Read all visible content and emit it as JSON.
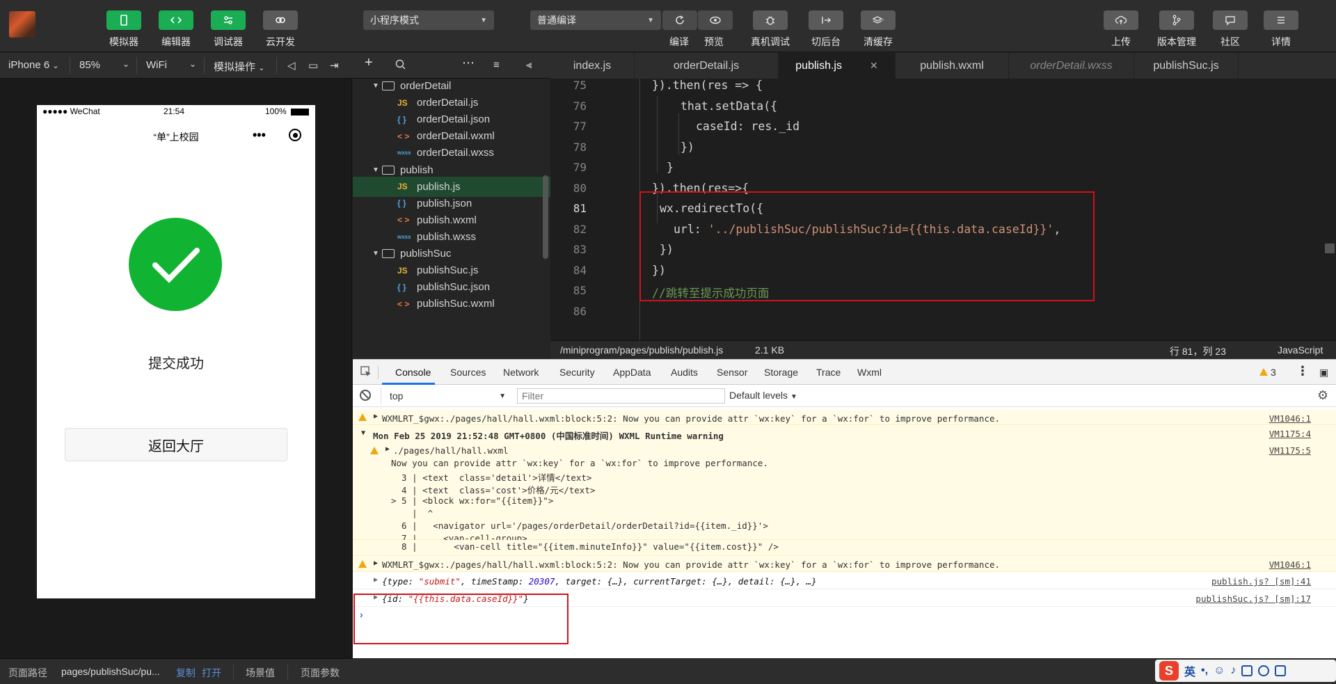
{
  "toolbar": {
    "simulator": "模拟器",
    "editor": "编辑器",
    "debugger": "调试器",
    "cloud": "云开发",
    "mode_select": "小程序模式",
    "compile_select": "普通编译",
    "compile": "编译",
    "preview": "预览",
    "real_debug": "真机调试",
    "background": "切后台",
    "clear_cache": "清缓存",
    "upload": "上传",
    "version_mgmt": "版本管理",
    "community": "社区",
    "details": "详情"
  },
  "device_bar": {
    "device": "iPhone 6",
    "zoom": "85%",
    "network": "WiFi",
    "simulate_op": "模拟操作"
  },
  "phone": {
    "carrier": "●●●●● WeChat",
    "time": "21:54",
    "battery": "100%",
    "nav_title": "“单”上校园",
    "success_text": "提交成功",
    "back_button": "返回大厅"
  },
  "file_tree": [
    {
      "type": "folder",
      "label": "orderDetail"
    },
    {
      "type": "js",
      "label": "orderDetail.js"
    },
    {
      "type": "json",
      "label": "orderDetail.json"
    },
    {
      "type": "wxml",
      "label": "orderDetail.wxml"
    },
    {
      "type": "wxss",
      "label": "orderDetail.wxss"
    },
    {
      "type": "folder",
      "label": "publish"
    },
    {
      "type": "js",
      "label": "publish.js",
      "active": true
    },
    {
      "type": "json",
      "label": "publish.json"
    },
    {
      "type": "wxml",
      "label": "publish.wxml"
    },
    {
      "type": "wxss",
      "label": "publish.wxss"
    },
    {
      "type": "folder",
      "label": "publishSuc"
    },
    {
      "type": "js",
      "label": "publishSuc.js"
    },
    {
      "type": "json",
      "label": "publishSuc.json"
    },
    {
      "type": "wxml",
      "label": "publishSuc.wxml"
    }
  ],
  "tabs": [
    "index.js",
    "orderDetail.js",
    "publish.js",
    "publish.wxml",
    "orderDetail.wxss",
    "publishSuc.js"
  ],
  "code_lines": [
    {
      "n": "75",
      "text": "}).then(res => {"
    },
    {
      "n": "76",
      "text": "that.setData({"
    },
    {
      "n": "77",
      "text": "caseId: res._id"
    },
    {
      "n": "78",
      "text": "})"
    },
    {
      "n": "79",
      "text": "}"
    },
    {
      "n": "80",
      "text": "}).then(res=>{"
    },
    {
      "n": "81",
      "text": "wx.redirectTo({"
    },
    {
      "n": "82",
      "text_a": "url: ",
      "text_b": "'../publishSuc/publishSuc?id={{this.data.caseId}}'",
      "text_c": ","
    },
    {
      "n": "83",
      "text": "})"
    },
    {
      "n": "84",
      "text": "})"
    },
    {
      "n": "85",
      "text": "//跳转至提示成功页面"
    },
    {
      "n": "86",
      "text": ""
    }
  ],
  "status_line": {
    "path": "/miniprogram/pages/publish/publish.js",
    "size": "2.1 KB",
    "position": "行 81，列 23",
    "language": "JavaScript"
  },
  "devtools": {
    "tabs": [
      "Console",
      "Sources",
      "Network",
      "Security",
      "AppData",
      "Audits",
      "Sensor",
      "Storage",
      "Trace",
      "Wxml"
    ],
    "warn_count": "3",
    "context": "top",
    "filter_placeholder": "Filter",
    "levels": "Default levels",
    "lines": {
      "l1": "WXMLRT_$gwx:./pages/hall/hall.wxml:block:5:2: Now you can provide attr `wx:key` for a `wx:for` to improve performance.",
      "l1_src": "VM1046:1",
      "l2": "Mon Feb 25 2019 21:52:48 GMT+0800 (中国标准时间) WXML Runtime warning",
      "l2_src": "VM1175:4",
      "l3": "./pages/hall/hall.wxml",
      "l3_src": "VM1175:5",
      "l4": "Now you can provide attr `wx:key` for a `wx:for` to improve performance.",
      "l5": "  3 | <text  class='detail'>详情</text>",
      "l6": "  4 | <text  class='cost'>价格/元</text>",
      "l7": "> 5 | <block wx:for=\"{{item}}\">",
      "l8": "    |  ^",
      "l9": "  6 |   <navigator url='/pages/orderDetail/orderDetail?id={{item._id}}'>",
      "l10": "  7 |     <van-cell-group>",
      "l11": "  8 |       <van-cell title=\"{{item.minuteInfo}}\" value=\"{{item.cost}}\" />",
      "l12": "WXMLRT_$gwx:./pages/hall/hall.wxml:block:5:2: Now you can provide attr `wx:key` for a `wx:for` to improve performance.",
      "l12_src": "VM1046:1",
      "l13_prefix": "{type: ",
      "l13_type": "\"submit\"",
      "l13_mid": ", timeStamp: ",
      "l13_ts": "20307",
      "l13_rest": ", target: {…}, currentTarget: {…}, detail: {…}, …}",
      "l13_src": "publish.js? [sm]:41",
      "l14_prefix": "{id: ",
      "l14_val": "\"{{this.data.caseId}}\"",
      "l14_suffix": "}",
      "l14_src": "publishSuc.js? [sm]:17"
    }
  },
  "bottom": {
    "path_label": "页面路径",
    "path_value": "pages/publishSuc/pu...",
    "copy": "复制",
    "open": "打开",
    "scene": "场景值",
    "params": "页面参数"
  },
  "ime": {
    "label": "英"
  }
}
